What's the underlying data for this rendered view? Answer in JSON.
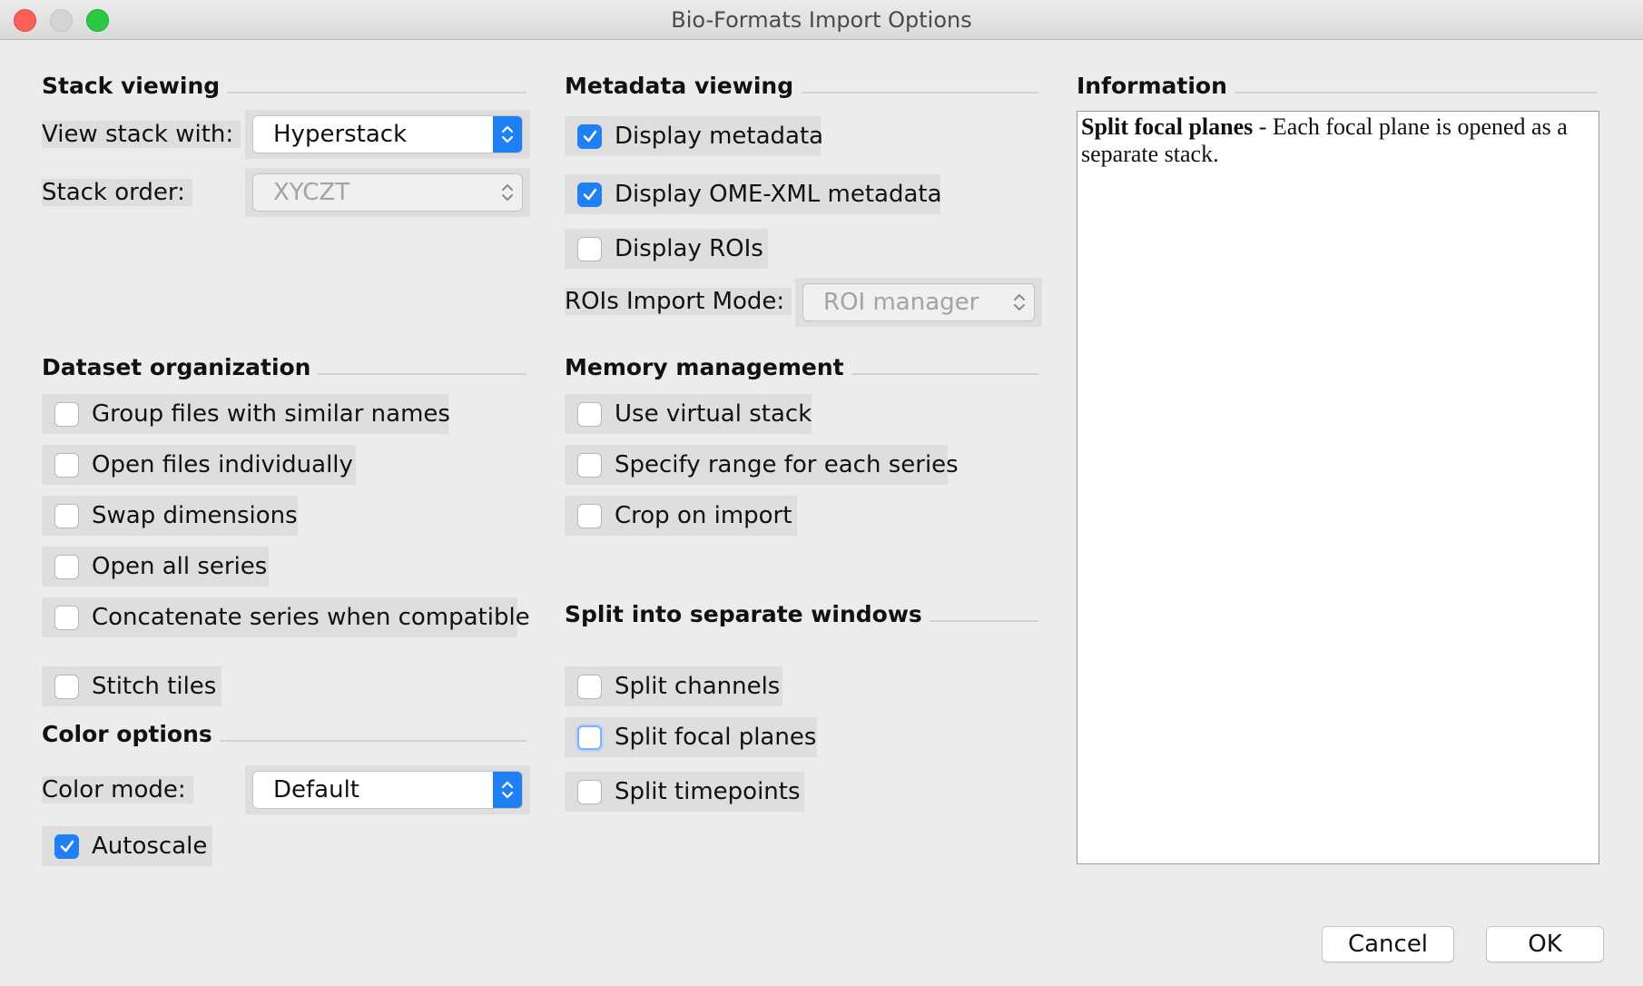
{
  "window": {
    "title": "Bio-Formats Import Options"
  },
  "stack_viewing": {
    "title": "Stack viewing",
    "view_label": "View stack with:",
    "view_value": "Hyperstack",
    "order_label": "Stack order:",
    "order_value": "XYCZT"
  },
  "metadata_viewing": {
    "title": "Metadata viewing",
    "display_metadata": "Display metadata",
    "display_omexml": "Display OME-XML metadata",
    "display_rois": "Display ROIs",
    "rois_mode_label": "ROIs Import Mode:",
    "rois_mode_value": "ROI manager"
  },
  "information": {
    "title": "Information",
    "heading": "Split focal planes",
    "text": " - Each focal plane is opened as a separate stack."
  },
  "dataset_organization": {
    "title": "Dataset organization",
    "group_files": "Group files with similar names",
    "open_individually": "Open files individually",
    "swap_dimensions": "Swap dimensions",
    "open_all_series": "Open all series",
    "concatenate": "Concatenate series when compatible",
    "stitch_tiles": "Stitch tiles"
  },
  "memory_management": {
    "title": "Memory management",
    "virtual_stack": "Use virtual stack",
    "specify_range": "Specify range for each series",
    "crop": "Crop on import"
  },
  "split_windows": {
    "title": "Split into separate windows",
    "channels": "Split channels",
    "focal_planes": "Split focal planes",
    "timepoints": "Split timepoints"
  },
  "color_options": {
    "title": "Color options",
    "mode_label": "Color mode:",
    "mode_value": "Default",
    "autoscale": "Autoscale"
  },
  "buttons": {
    "cancel": "Cancel",
    "ok": "OK"
  },
  "colors": {
    "accent": "#1f7ff5",
    "panel": "#ececec",
    "item_bg": "#dedede"
  }
}
